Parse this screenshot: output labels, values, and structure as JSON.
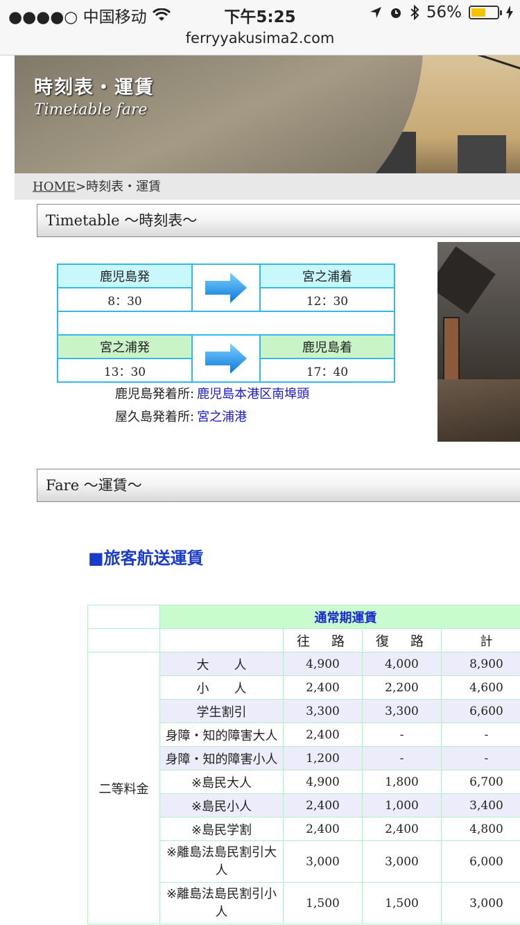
{
  "status_bar": {
    "carrier": "●●●●○ 中国移动",
    "time": "下午5:25",
    "battery": "56%",
    "battery_level": 0.56
  },
  "browser": {
    "url": "ferryyakusima2.com"
  },
  "banner": {
    "title": "時刻表・運賃",
    "subtitle": "Timetable fare"
  },
  "breadcrumb": {
    "home": "HOME",
    "separator": ">",
    "current": "時刻表・運賃"
  },
  "timetable": {
    "section_title": "Timetable ～時刻表～",
    "rows": [
      {
        "from": "鹿児島発",
        "from_time": "8：30",
        "to": "宮之浦着",
        "to_time": "12：30"
      },
      {
        "from": "宮之浦発",
        "from_time": "13：30",
        "to": "鹿児島着",
        "to_time": "17：40"
      }
    ],
    "ports": [
      {
        "label": "鹿児島発着所:",
        "value": "鹿児島本港区南埠頭"
      },
      {
        "label": "屋久島発着所:",
        "value": "宮之浦港"
      }
    ]
  },
  "fare": {
    "section_title": "Fare ～運賃～",
    "heading": "■旅客航送運賃",
    "caption": "通常期運賃",
    "columns": [
      "往　路",
      "復　路",
      "計"
    ],
    "category": "二等料金",
    "rows": [
      {
        "label": "大　　人",
        "values": [
          "4,900",
          "4,000",
          "8,900"
        ]
      },
      {
        "label": "小　　人",
        "values": [
          "2,400",
          "2,200",
          "4,600"
        ]
      },
      {
        "label": "学生割引",
        "values": [
          "3,300",
          "3,300",
          "6,600"
        ]
      },
      {
        "label": "身障・知的障害大人",
        "values": [
          "2,400",
          "-",
          "-"
        ]
      },
      {
        "label": "身障・知的障害小人",
        "values": [
          "1,200",
          "-",
          "-"
        ]
      },
      {
        "label": "※島民大人",
        "values": [
          "4,900",
          "1,800",
          "6,700"
        ]
      },
      {
        "label": "※島民小人",
        "values": [
          "2,400",
          "1,000",
          "3,400"
        ]
      },
      {
        "label": "※島民学割",
        "values": [
          "2,400",
          "2,400",
          "4,800"
        ]
      },
      {
        "label": "※離島法島民割引大人",
        "values": [
          "3,000",
          "3,000",
          "6,000"
        ]
      },
      {
        "label": "※離島法島民割引小人",
        "values": [
          "1,500",
          "1,500",
          "3,000"
        ]
      }
    ]
  }
}
